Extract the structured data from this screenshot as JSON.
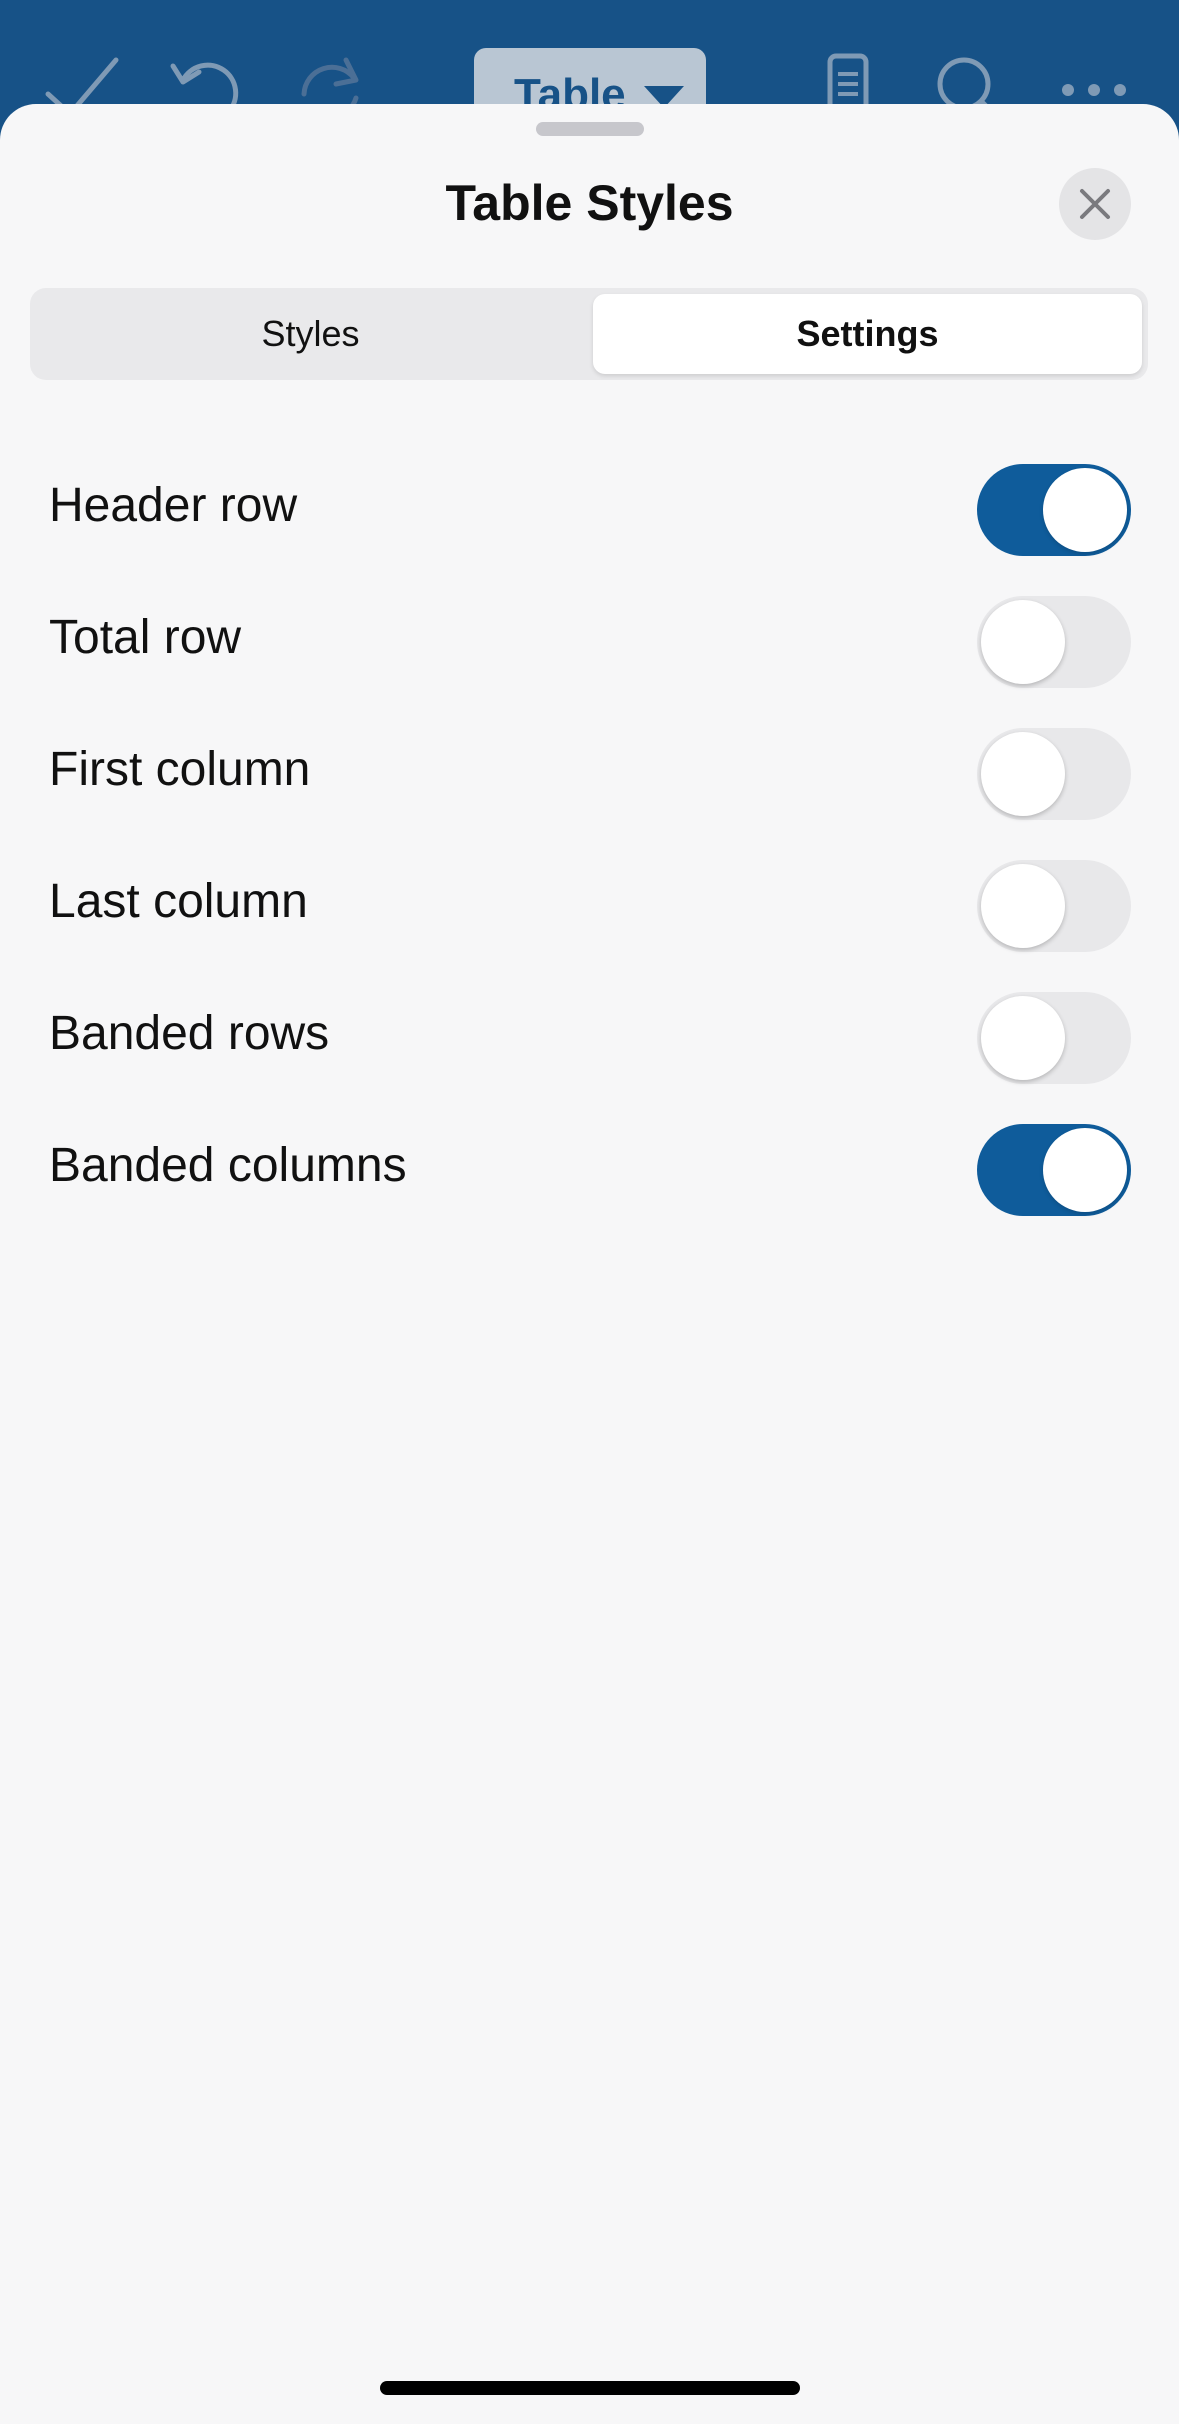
{
  "toolbar": {
    "context_menu_label": "Table",
    "icons": [
      "checkmark-icon",
      "undo-icon",
      "redo-icon",
      "mobile-view-icon",
      "search-icon",
      "more-icon"
    ]
  },
  "sheet": {
    "title": "Table Styles",
    "close_icon": "close-icon"
  },
  "tabs": [
    {
      "label": "Styles",
      "selected": false
    },
    {
      "label": "Settings",
      "selected": true
    }
  ],
  "settings": [
    {
      "label": "Header row",
      "on": true
    },
    {
      "label": "Total row",
      "on": false
    },
    {
      "label": "First column",
      "on": false
    },
    {
      "label": "Last column",
      "on": false
    },
    {
      "label": "Banded rows",
      "on": false
    },
    {
      "label": "Banded columns",
      "on": true
    }
  ],
  "colors": {
    "accent": "#0f5c9b",
    "toolbar_bg": "#175287",
    "sheet_bg": "#f7f7f8"
  }
}
